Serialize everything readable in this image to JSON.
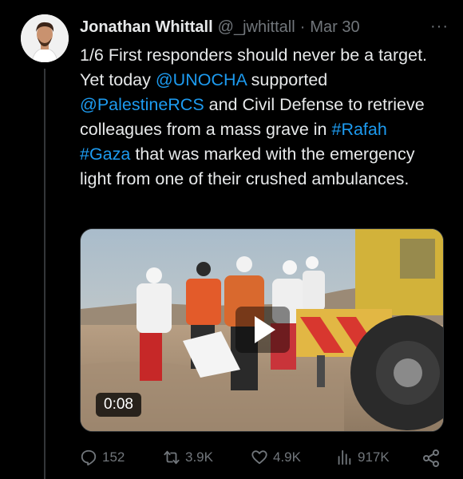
{
  "tweet": {
    "author_name": "Jonathan Whittall",
    "handle": "@_jwhittall",
    "separator": "·",
    "date": "Mar 30",
    "more": "···",
    "text_segments": [
      {
        "text": "1/6 First responders should never be a target. Yet today ",
        "link": false
      },
      {
        "text": "@UNOCHA",
        "link": true
      },
      {
        "text": " supported ",
        "link": false
      },
      {
        "text": "@PalestineRCS",
        "link": true
      },
      {
        "text": " and Civil Defense to retrieve colleagues from a mass grave in ",
        "link": false
      },
      {
        "text": "#Rafah",
        "link": true
      },
      {
        "text": " ",
        "link": false
      },
      {
        "text": "#Gaza",
        "link": true
      },
      {
        "text": " that was marked with the emergency light from one of their crushed ambulances.",
        "link": false
      }
    ]
  },
  "media": {
    "duration": "0:08"
  },
  "actions": {
    "reply_count": "152",
    "retweet_count": "3.9K",
    "like_count": "4.9K",
    "view_count": "917K"
  },
  "colors": {
    "background": "#000000",
    "text": "#e7e9ea",
    "muted": "#71767b",
    "link": "#1d9bf0"
  },
  "icons": [
    "more-icon",
    "play-icon",
    "reply-icon",
    "retweet-icon",
    "like-icon",
    "views-icon",
    "share-icon"
  ]
}
